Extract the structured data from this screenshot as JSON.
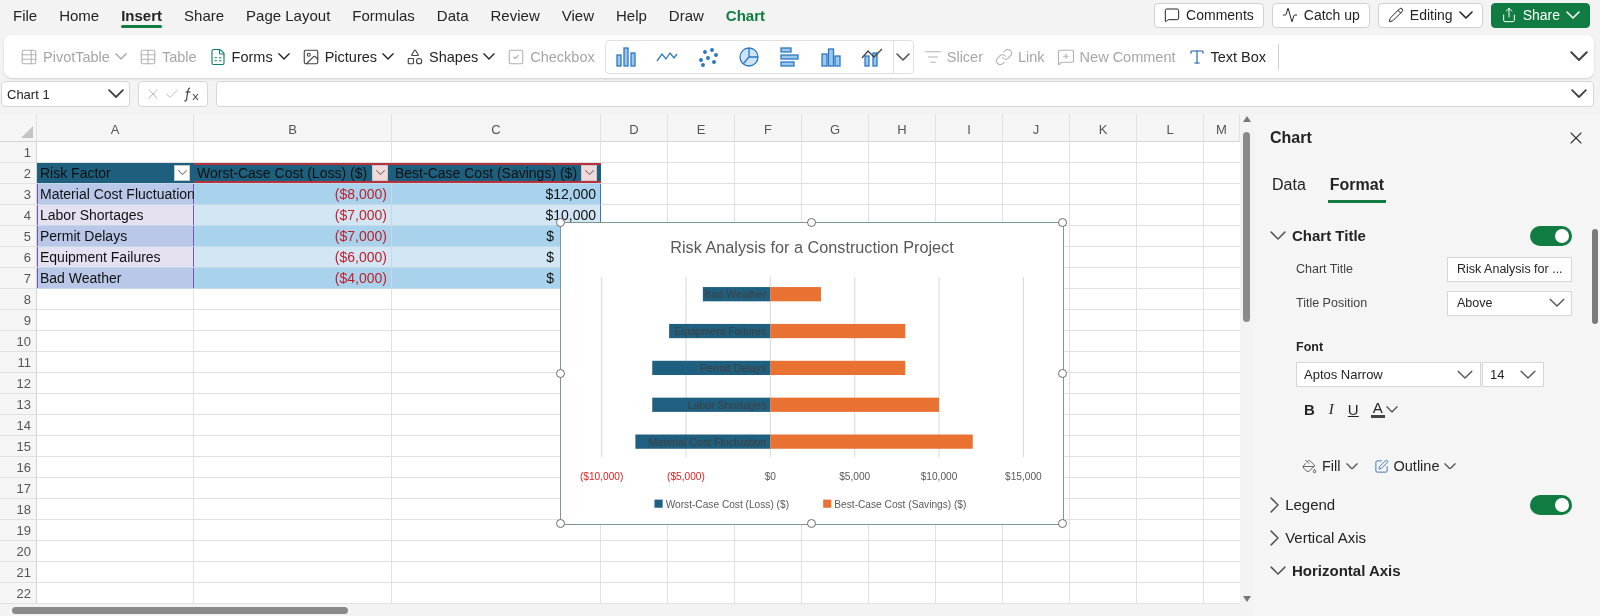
{
  "menu_bar": {
    "tabs": [
      {
        "label": "File",
        "selected": false,
        "kind": "normal"
      },
      {
        "label": "Home",
        "selected": false,
        "kind": "normal"
      },
      {
        "label": "Insert",
        "selected": true,
        "kind": "normal"
      },
      {
        "label": "Share",
        "selected": false,
        "kind": "normal"
      },
      {
        "label": "Page Layout",
        "selected": false,
        "kind": "normal"
      },
      {
        "label": "Formulas",
        "selected": false,
        "kind": "normal"
      },
      {
        "label": "Data",
        "selected": false,
        "kind": "normal"
      },
      {
        "label": "Review",
        "selected": false,
        "kind": "normal"
      },
      {
        "label": "View",
        "selected": false,
        "kind": "normal"
      },
      {
        "label": "Help",
        "selected": false,
        "kind": "normal"
      },
      {
        "label": "Draw",
        "selected": false,
        "kind": "normal"
      },
      {
        "label": "Chart",
        "selected": false,
        "kind": "contextual"
      }
    ],
    "buttons": [
      {
        "label": "Comments",
        "kind": "comments"
      },
      {
        "label": "Catch up",
        "kind": "catchup"
      },
      {
        "label": "Editing",
        "kind": "editing"
      },
      {
        "label": "Share",
        "kind": "share"
      }
    ]
  },
  "ribbon": {
    "items": [
      {
        "label": "PivotTable",
        "kind": "pivot",
        "disabled": true,
        "dropdown": true
      },
      {
        "label": "Table",
        "kind": "table",
        "disabled": true,
        "dropdown": false
      },
      {
        "label": "Forms",
        "kind": "forms",
        "disabled": false,
        "dropdown": true
      },
      {
        "label": "Pictures",
        "kind": "pictures",
        "disabled": false,
        "dropdown": true
      },
      {
        "label": "Shapes",
        "kind": "shapes",
        "disabled": false,
        "dropdown": true
      },
      {
        "label": "Checkbox",
        "kind": "checkbox",
        "disabled": true,
        "dropdown": false
      },
      {
        "kind": "chart-gallery"
      },
      {
        "label": "Slicer",
        "kind": "slicer",
        "disabled": true,
        "dropdown": false
      },
      {
        "label": "Link",
        "kind": "link",
        "disabled": true,
        "dropdown": false
      },
      {
        "label": "New Comment",
        "kind": "new-comment",
        "disabled": true,
        "dropdown": false
      },
      {
        "label": "Text Box",
        "kind": "text-box",
        "disabled": false,
        "dropdown": false
      }
    ]
  },
  "name_box": {
    "value": "Chart 1"
  },
  "sheet": {
    "columns": [
      "A",
      "B",
      "C",
      "D",
      "E",
      "F",
      "G",
      "H",
      "I",
      "J",
      "K",
      "L",
      "M"
    ],
    "rows": [
      {
        "number": "1",
        "cells": []
      },
      {
        "number": "2",
        "cells": [
          {
            "text": "Risk Factor",
            "kind": "header",
            "filter": true
          },
          {
            "text": "Worst-Case Cost (Loss) ($)",
            "kind": "header",
            "filter": true
          },
          {
            "text": "Best-Case Cost (Savings) ($)",
            "kind": "header",
            "filter": true
          }
        ]
      },
      {
        "number": "3",
        "cells": [
          {
            "text": "Material Cost Fluctuation",
            "kind": "text"
          },
          {
            "text": "($8,000)",
            "kind": "amount",
            "negative": true
          },
          {
            "text": "$12,000",
            "kind": "amount",
            "negative": false
          }
        ]
      },
      {
        "number": "4",
        "cells": [
          {
            "text": "Labor Shortages",
            "kind": "text"
          },
          {
            "text": "($7,000)",
            "kind": "amount",
            "negative": true
          },
          {
            "text": "$10,000",
            "kind": "amount",
            "negative": false
          }
        ]
      },
      {
        "number": "5",
        "cells": [
          {
            "text": "Permit Delays",
            "kind": "text"
          },
          {
            "text": "($7,000)",
            "kind": "amount",
            "negative": true
          },
          {
            "text": "$",
            "kind": "amount",
            "negative": false
          }
        ]
      },
      {
        "number": "6",
        "cells": [
          {
            "text": "Equipment Failures",
            "kind": "text"
          },
          {
            "text": "($6,000)",
            "kind": "amount",
            "negative": true
          },
          {
            "text": "$",
            "kind": "amount",
            "negative": false
          }
        ]
      },
      {
        "number": "7",
        "cells": [
          {
            "text": "Bad Weather",
            "kind": "text"
          },
          {
            "text": "($4,000)",
            "kind": "amount",
            "negative": true
          },
          {
            "text": "$",
            "kind": "amount",
            "negative": false
          }
        ]
      },
      {
        "number": "8",
        "cells": []
      },
      {
        "number": "9",
        "cells": []
      },
      {
        "number": "10",
        "cells": []
      },
      {
        "number": "11",
        "cells": []
      },
      {
        "number": "12",
        "cells": []
      },
      {
        "number": "13",
        "cells": []
      },
      {
        "number": "14",
        "cells": []
      },
      {
        "number": "15",
        "cells": []
      },
      {
        "number": "16",
        "cells": []
      },
      {
        "number": "17",
        "cells": []
      },
      {
        "number": "18",
        "cells": []
      },
      {
        "number": "19",
        "cells": []
      },
      {
        "number": "20",
        "cells": []
      },
      {
        "number": "21",
        "cells": []
      },
      {
        "number": "22",
        "cells": []
      }
    ]
  },
  "chart": {
    "chart_data": {
      "type": "bar",
      "orientation": "horizontal",
      "title": "Risk Analysis for a Construction Project",
      "categories": [
        "Bad Weather",
        "Equipment Failures",
        "Permit Delays",
        "Labor Shortages",
        "Material Cost Fluctuation"
      ],
      "series": [
        {
          "name": "Worst-Case Cost (Loss) ($)",
          "color": "#1f5f7f",
          "values": [
            -4000,
            -6000,
            -7000,
            -7000,
            -8000
          ]
        },
        {
          "name": "Best-Case Cost (Savings) ($)",
          "color": "#e97132",
          "values": [
            3000,
            8000,
            8000,
            10000,
            12000
          ]
        }
      ],
      "stacked": true,
      "grid": true,
      "legend": true,
      "xlim": [
        -10000,
        15000
      ],
      "xticks": [
        {
          "value": -10000,
          "label": "($10,000)"
        },
        {
          "value": -5000,
          "label": "($5,000)"
        },
        {
          "value": 0,
          "label": "$0"
        },
        {
          "value": 5000,
          "label": "$5,000"
        },
        {
          "value": 10000,
          "label": "$10,000"
        },
        {
          "value": 15000,
          "label": "$15,000"
        }
      ]
    }
  },
  "format_pane": {
    "title": "Chart",
    "tabs": [
      {
        "label": "Data",
        "selected": false
      },
      {
        "label": "Format",
        "selected": true
      }
    ],
    "sections": [
      {
        "label": "Chart Title",
        "expanded": true,
        "toggle": {
          "on": true
        },
        "fields": [
          {
            "label": "Chart Title",
            "kind": "text",
            "value": "Risk Analysis for ..."
          },
          {
            "label": "Title Position",
            "kind": "select",
            "value": "Above"
          }
        ],
        "font": {
          "label": "Font",
          "family": "Aptos Narrow",
          "size": "14"
        },
        "style_buttons": [
          {
            "label": "B",
            "kind": "bold"
          },
          {
            "label": "I",
            "kind": "italic"
          },
          {
            "label": "U",
            "kind": "underline"
          },
          {
            "label": "A",
            "kind": "color"
          }
        ],
        "fill_buttons": [
          {
            "label": "Fill",
            "kind": "fill"
          },
          {
            "label": "Outline",
            "kind": "outline"
          }
        ]
      },
      {
        "label": "Legend",
        "expanded": false,
        "toggle": {
          "on": true
        }
      },
      {
        "label": "Vertical Axis",
        "expanded": false
      },
      {
        "label": "Horizontal Axis",
        "expanded": true
      }
    ]
  }
}
